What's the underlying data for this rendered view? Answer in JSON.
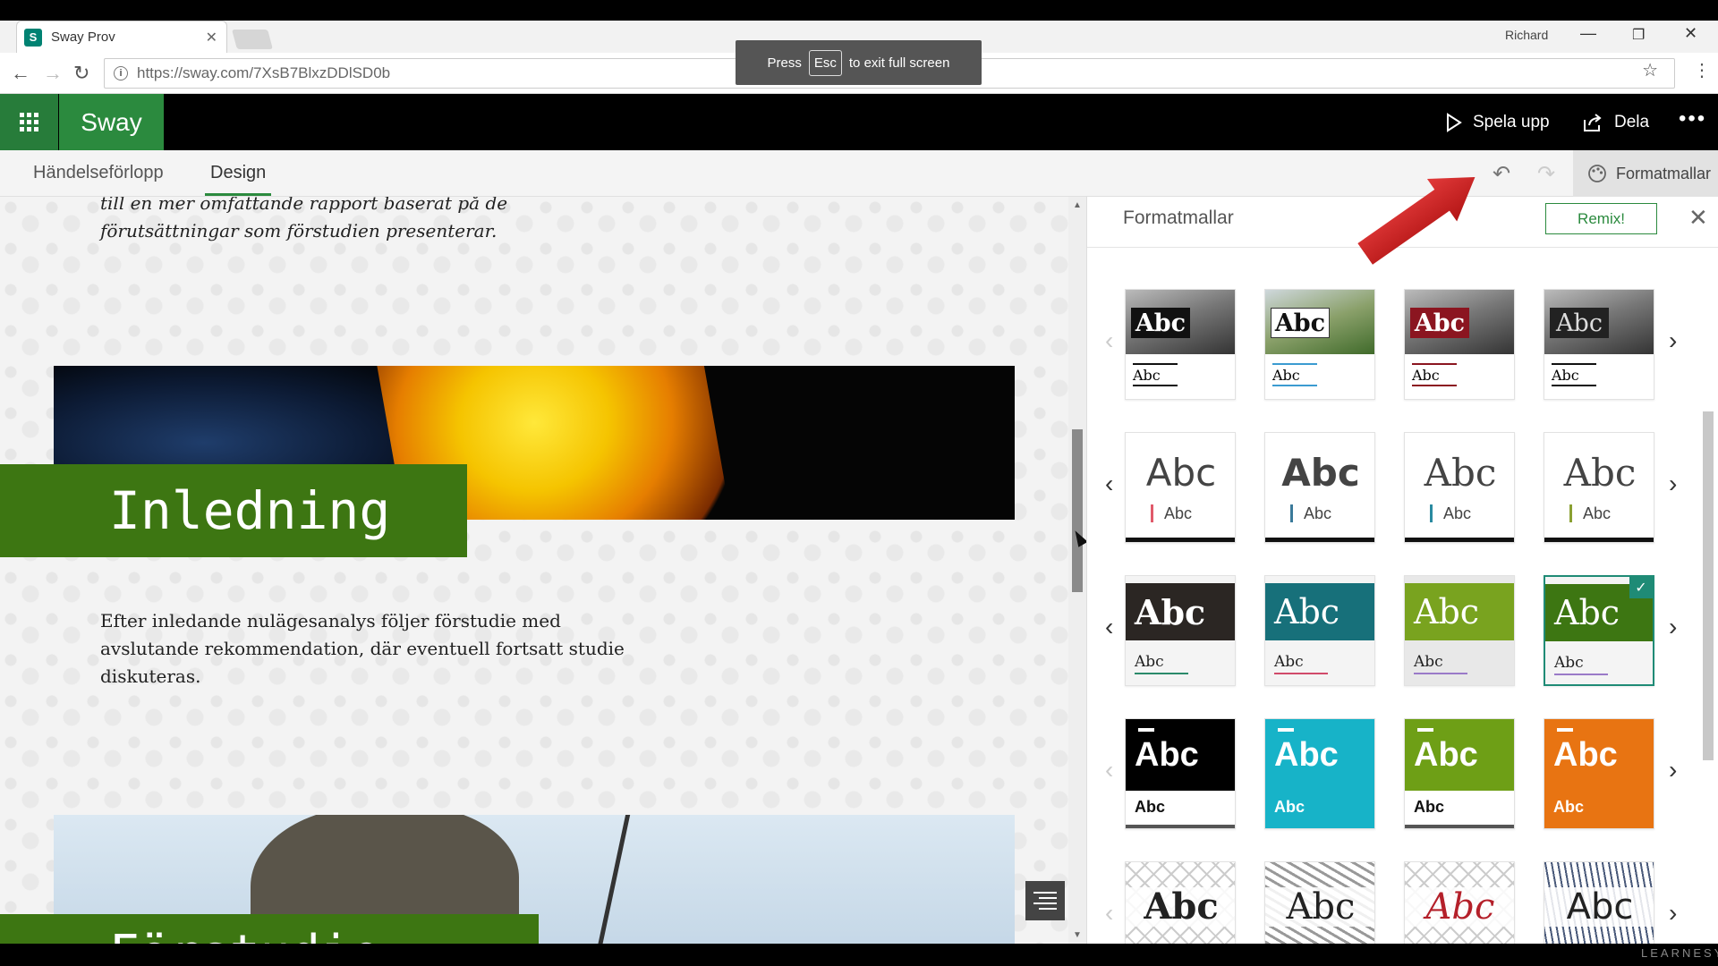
{
  "browser": {
    "tab_title": "Sway Prov",
    "tab_favicon": "S",
    "user": "Richard",
    "url": "https://sway.com/7XsB7BlxzDDlSD0b",
    "fullscreen_msg": {
      "press": "Press",
      "key": "Esc",
      "rest": "to exit full screen"
    }
  },
  "header": {
    "brand": "Sway",
    "play_label": "Spela upp",
    "share_label": "Dela"
  },
  "tabs": [
    {
      "label": "Händelseförlopp"
    },
    {
      "label": "Design"
    }
  ],
  "toolbar": {
    "styles_label": "Formatmallar"
  },
  "canvas": {
    "intro_text": "till en mer omfattande rapport baserat på de förutsättningar som förstudien presenterar.",
    "section1_title": "Inledning",
    "section1_text": "Efter inledande nulägesanalys följer förstudie med avslutande rekommendation, där eventuell fortsatt studie diskuteras.",
    "section2_title": "Förstudie"
  },
  "panel": {
    "title": "Formatmallar",
    "remix_label": "Remix!",
    "card_big": "Abc",
    "card_small": "Abc",
    "accent": "#1f8b76"
  },
  "watermark": "LEARNESY"
}
